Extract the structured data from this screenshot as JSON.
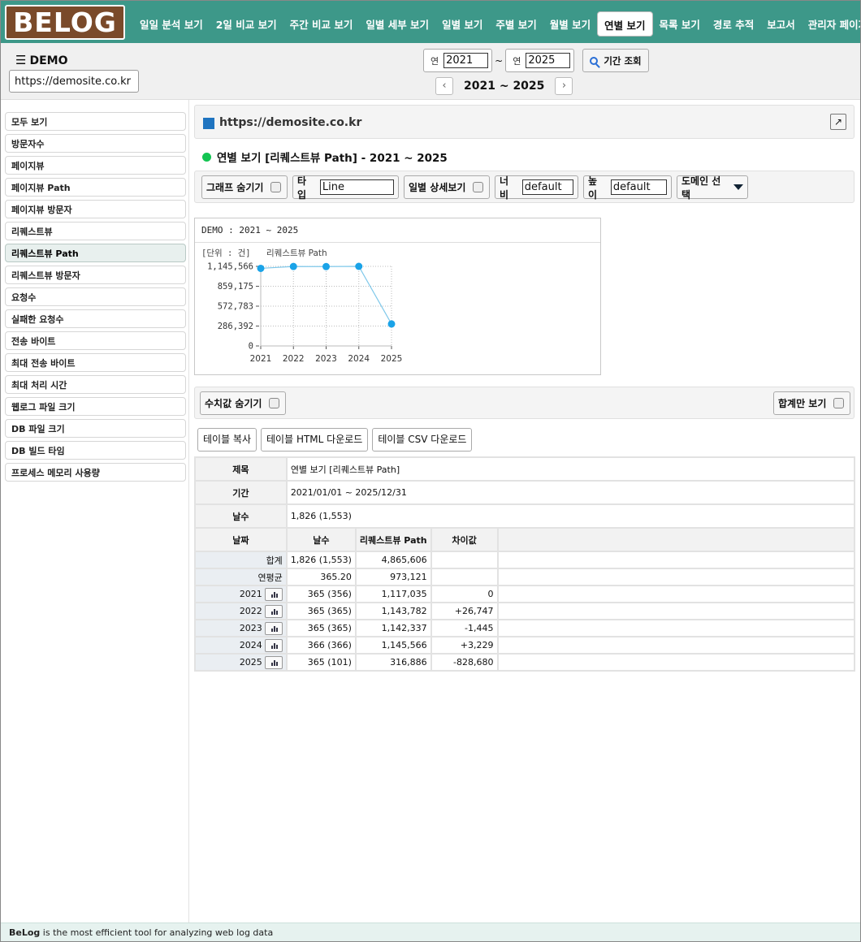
{
  "logo": "BELOG",
  "nav": [
    "일일 분석 보기",
    "2일 비교 보기",
    "주간 비교 보기",
    "일별 세부 보기",
    "일별 보기",
    "주별 보기",
    "월별 보기",
    "연별 보기",
    "목록 보기",
    "경로 추적",
    "보고서",
    "관리자 페이지"
  ],
  "nav_active": "연별 보기",
  "site": {
    "title": "DEMO",
    "url": "https://demosite.co.kr"
  },
  "range": {
    "year_label": "연",
    "from": "2021",
    "to": "2025",
    "tilde": "~",
    "search": "기간 조회",
    "period_text": "2021 ~ 2025",
    "prev": "‹",
    "next": "›"
  },
  "sidebar": [
    "모두 보기",
    "방문자수",
    "페이지뷰",
    "페이지뷰 Path",
    "페이지뷰 방문자",
    "리퀘스트뷰",
    "리퀘스트뷰 Path",
    "리퀘스트뷰 방문자",
    "요청수",
    "실패한 요청수",
    "전송 바이트",
    "최대 전송 바이트",
    "최대 처리 시간",
    "웹로그 파일 크기",
    "DB 파일 크기",
    "DB 빌드 타임",
    "프로세스 메모리 사용량"
  ],
  "sidebar_active": "리퀘스트뷰 Path",
  "main": {
    "url": "https://demosite.co.kr",
    "report_title": "연별 보기 [리퀘스트뷰 Path] - 2021 ~ 2025",
    "options": {
      "hide_graph": "그래프 숨기기",
      "type_label": "타입",
      "type_value": "Line",
      "daily_detail": "일별 상세보기",
      "width_label": "너비",
      "width_value": "default",
      "height_label": "높이",
      "height_value": "default",
      "domain_select": "도메인 선택"
    },
    "hide_values": "수치값 숨기기",
    "total_only": "합계만 보기",
    "table_buttons": [
      "테이블 복사",
      "테이블 HTML 다운로드",
      "테이블 CSV 다운로드"
    ]
  },
  "chart_data": {
    "type": "line",
    "title": "DEMO : 2021 ~ 2025",
    "unit_label": "[단위 : 건]",
    "series_name": "리퀘스트뷰 Path",
    "x": [
      "2021",
      "2022",
      "2023",
      "2024",
      "2025"
    ],
    "values": [
      1117035,
      1143782,
      1142337,
      1145566,
      316886
    ],
    "yticks": [
      0,
      286392,
      572783,
      859175,
      1145566
    ],
    "ytick_labels": [
      "0",
      "286,392",
      "572,783",
      "859,175",
      "1,145,566"
    ],
    "ylim": [
      0,
      1145566
    ],
    "line_color": "#7fc8ea",
    "marker_color": "#1aa3e8",
    "grid": true
  },
  "table": {
    "info": [
      {
        "label": "제목",
        "value": "연별 보기 [리퀘스트뷰 Path]"
      },
      {
        "label": "기간",
        "value": "2021/01/01 ~ 2025/12/31"
      },
      {
        "label": "날수",
        "value": "1,826 (1,553)"
      }
    ],
    "headers": [
      "날짜",
      "날수",
      "리퀘스트뷰 Path",
      "차이값"
    ],
    "rows": [
      {
        "date": "합계",
        "days": "1,826 (1,553)",
        "value": "4,865,606",
        "diff": "",
        "chart": false
      },
      {
        "date": "연평균",
        "days": "365.20",
        "value": "973,121",
        "diff": "",
        "chart": false
      },
      {
        "date": "2021",
        "days": "365 (356)",
        "value": "1,117,035",
        "diff": "0",
        "chart": true
      },
      {
        "date": "2022",
        "days": "365 (365)",
        "value": "1,143,782",
        "diff": "+26,747",
        "chart": true
      },
      {
        "date": "2023",
        "days": "365 (365)",
        "value": "1,142,337",
        "diff": "-1,445",
        "chart": true
      },
      {
        "date": "2024",
        "days": "366 (366)",
        "value": "1,145,566",
        "diff": "+3,229",
        "chart": true
      },
      {
        "date": "2025",
        "days": "365 (101)",
        "value": "316,886",
        "diff": "-828,680",
        "chart": true
      }
    ]
  },
  "footer": {
    "brand": "BeLog",
    "text": " is the most efficient tool for analyzing web log data"
  }
}
